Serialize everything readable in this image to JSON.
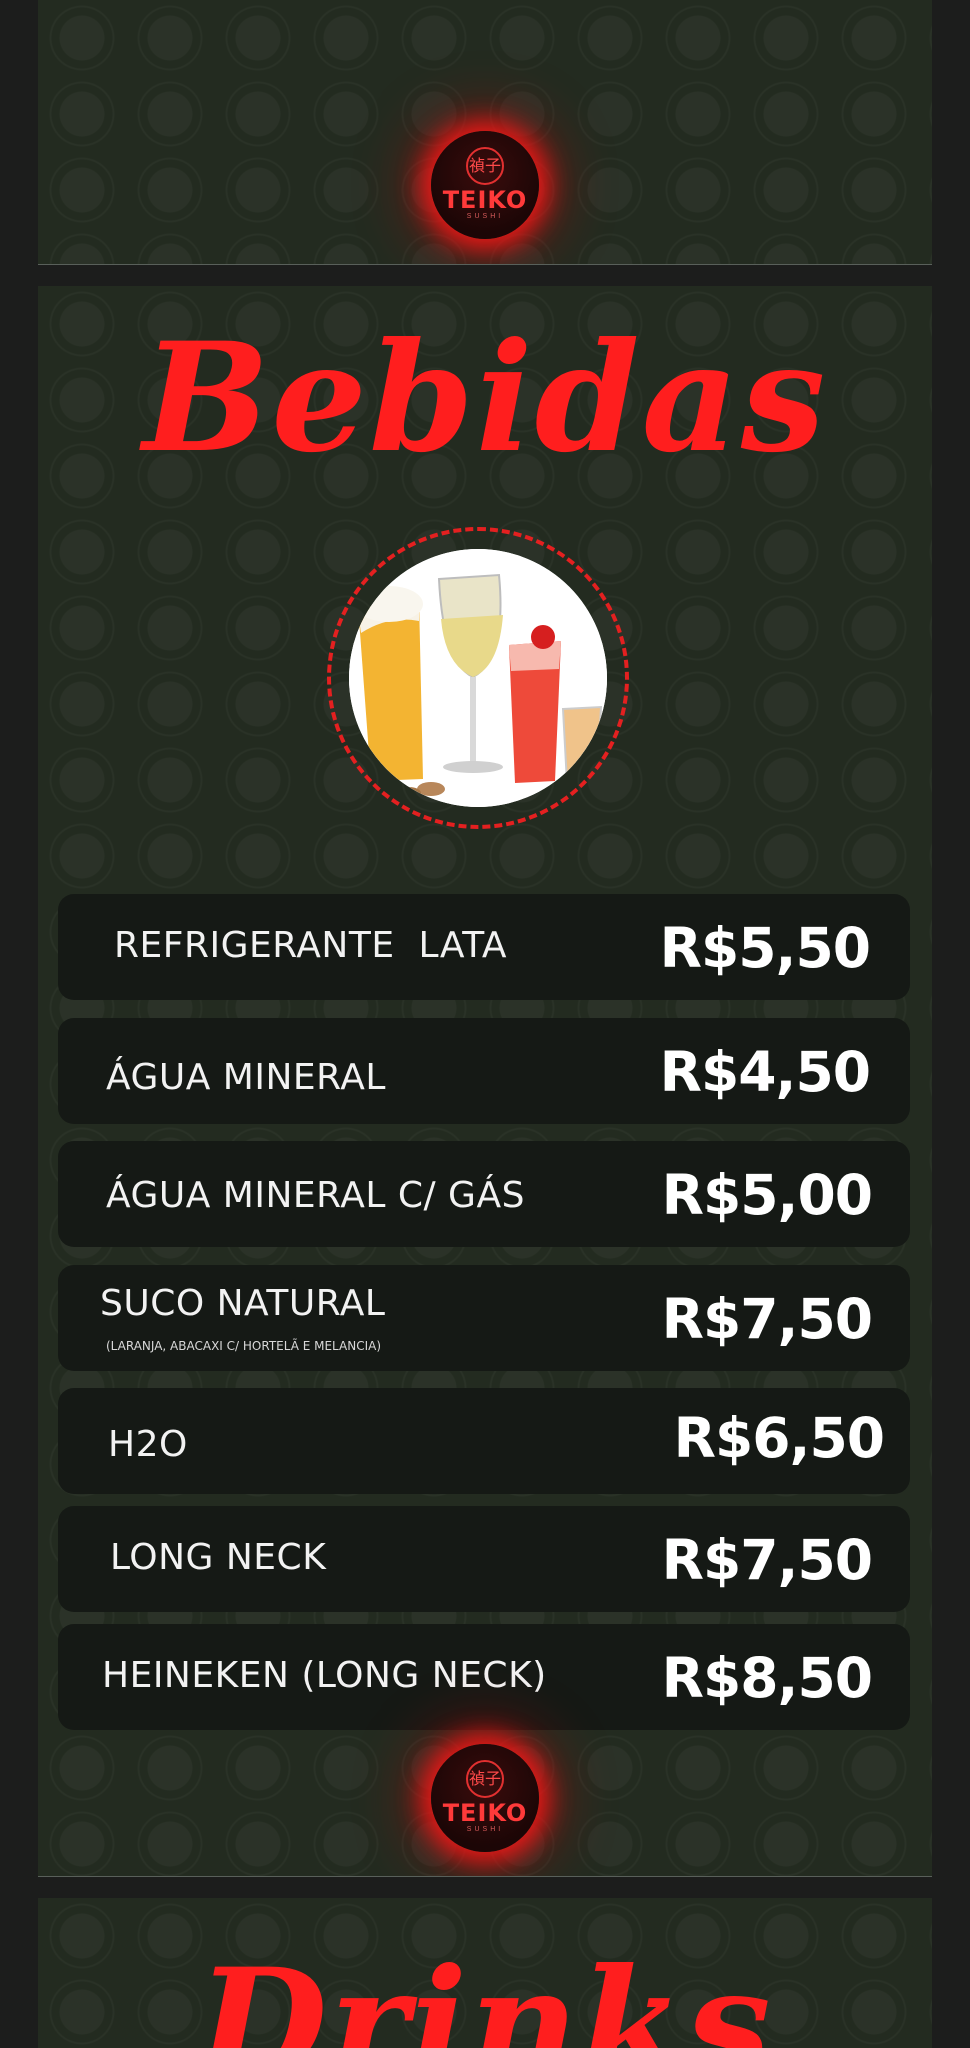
{
  "brand": {
    "kanji": "禎子",
    "name": "TEIKO",
    "sub": "SUSHI"
  },
  "section": {
    "title": "Bebidas",
    "items": [
      {
        "name": "REFRIGERANTE  LATA",
        "price": "R$5,50"
      },
      {
        "name": "ÁGUA MINERAL",
        "price": "R$4,50"
      },
      {
        "name": "ÁGUA MINERAL C/ GÁS",
        "price": "R$5,00"
      },
      {
        "name": "SUCO NATURAL",
        "note": "(LARANJA, ABACAXI C/ HORTELÃ E MELANCIA)",
        "price": "R$7,50"
      },
      {
        "name": "H2O",
        "price": "R$6,50"
      },
      {
        "name": "LONG NECK",
        "price": "R$7,50"
      },
      {
        "name": "HEINEKEN (LONG NECK)",
        "price": "R$8,50"
      }
    ]
  },
  "next_section": {
    "title": "Drinks"
  },
  "colors": {
    "accent": "#ff1e1e",
    "panel": "#232b20",
    "row": "#151915",
    "frame": "#1c1d1c"
  }
}
